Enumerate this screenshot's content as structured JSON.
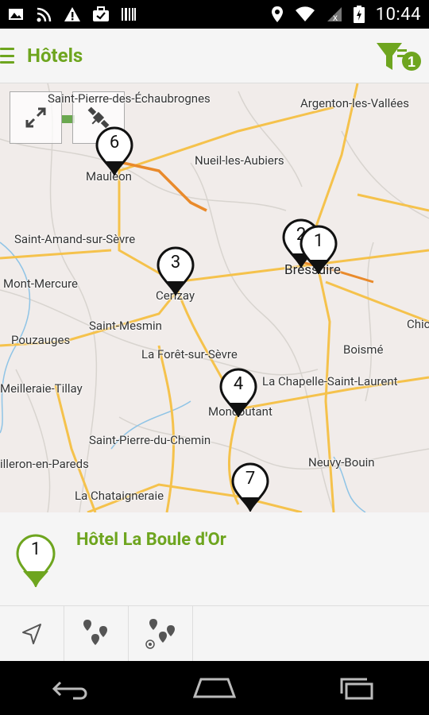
{
  "status_bar": {
    "time": "10:44"
  },
  "app_bar": {
    "title": "Hôtels",
    "filter_count": "1"
  },
  "map": {
    "towns": [
      "Saint-Pierre-des-Échaubrognes",
      "Argenton-les-Vallées",
      "Mauléon",
      "Nueil-les-Aubiers",
      "Saint-Amand-sur-Sèvre",
      "Bressuire",
      "Mont-Mercure",
      "Cerizay",
      "Chic",
      "Saint-Mesmin",
      "Pouzauges",
      "La Forêt-sur-Sèvre",
      "Boismé",
      "Meilleraie-Tillay",
      "La Chapelle-Saint-Laurent",
      "Moncoutant",
      "Saint-Pierre-du-Chemin",
      "illeron-en-Pareds",
      "Neuvy-Bouin",
      "La Chataigneraie"
    ],
    "markers": [
      "6",
      "3",
      "2",
      "1",
      "4",
      "7"
    ]
  },
  "detail": {
    "marker_number": "1",
    "hotel_name": "Hôtel La Boule d'Or"
  }
}
